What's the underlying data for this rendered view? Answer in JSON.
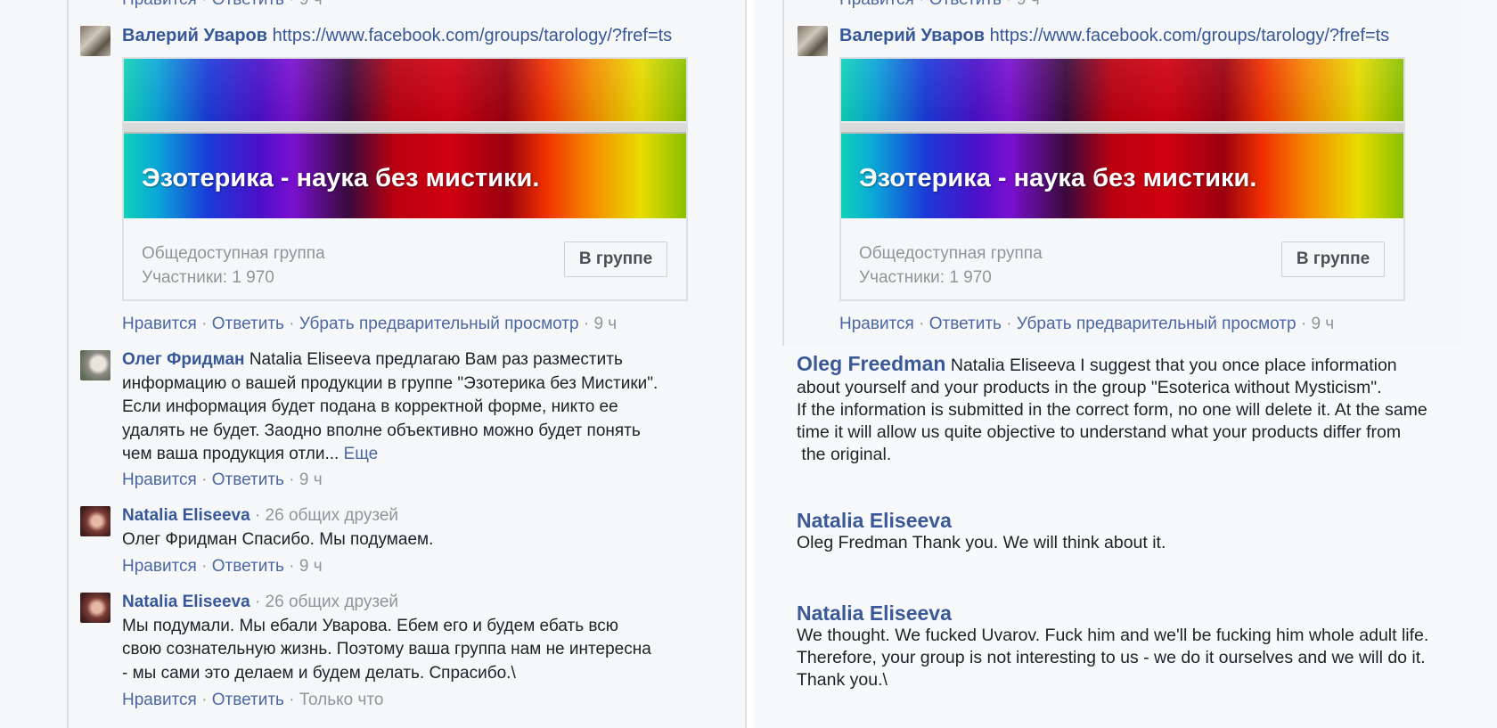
{
  "actions": {
    "like": "Нравится",
    "reply": "Ответить",
    "remove_preview": "Убрать предварительный просмотр",
    "sep": "·",
    "time_9h": "9 ч",
    "time_now": "Только что"
  },
  "comment_valery": {
    "author": "Валерий Уваров",
    "link": "https://www.facebook.com/groups/tarology/?fref=ts"
  },
  "group_card": {
    "banner_title": "Эзотерика - наука без мистики.",
    "privacy": "Общедоступная группа",
    "members": "Участники: 1 970",
    "button": "В группе"
  },
  "comment_oleg": {
    "author": "Олег Фридман",
    "lines": [
      "Natalia Eliseeva предлагаю Вам раз разместить",
      "информацию о вашей продукции в группе \"Эзотерика без Мистики\".",
      "Если информация будет подана в корректной форме, никто ее",
      "удалять не будет. Заодно вполне объективно можно будет понять",
      "чем ваша продукция отли..."
    ],
    "more": "Еще"
  },
  "comment_natalia_1": {
    "author": "Natalia Eliseeva",
    "mutual": "· 26 общих друзей",
    "text": "Олег Фридман Спасибо. Мы подумаем."
  },
  "comment_natalia_2": {
    "author": "Natalia Eliseeva",
    "mutual": "· 26 общих друзей",
    "lines": [
      "Мы подумали. Мы ебали Уварова. Ебем его и будем ебать всю",
      "свою сознательную жизнь. Поэтому ваша группа нам не интересна",
      "- мы сами это делаем и будем делать. Спрасибо.\\"
    ]
  },
  "translation": {
    "oleg": {
      "author": "Oleg Freedman",
      "lines": [
        "Natalia Eliseeva I suggest that you once place information",
        "about yourself and your products in the group \"Esoterica without Mysticism\".",
        "If the information is submitted in the correct form, no one will delete it. At the same",
        "time it will allow us quite objective to understand what your products differ from",
        " the original."
      ]
    },
    "natalia_1": {
      "author": "Natalia Eliseeva",
      "text": "Oleg Fredman Thank you. We will think about it."
    },
    "natalia_2": {
      "author": "Natalia Eliseeva",
      "lines": [
        "We thought. We fucked Uvarov. Fuck him and we'll be fucking him whole adult life.",
        "Therefore, your group is not interesting to us - we do it ourselves and we will do it.",
        "Thank you.\\"
      ]
    }
  }
}
